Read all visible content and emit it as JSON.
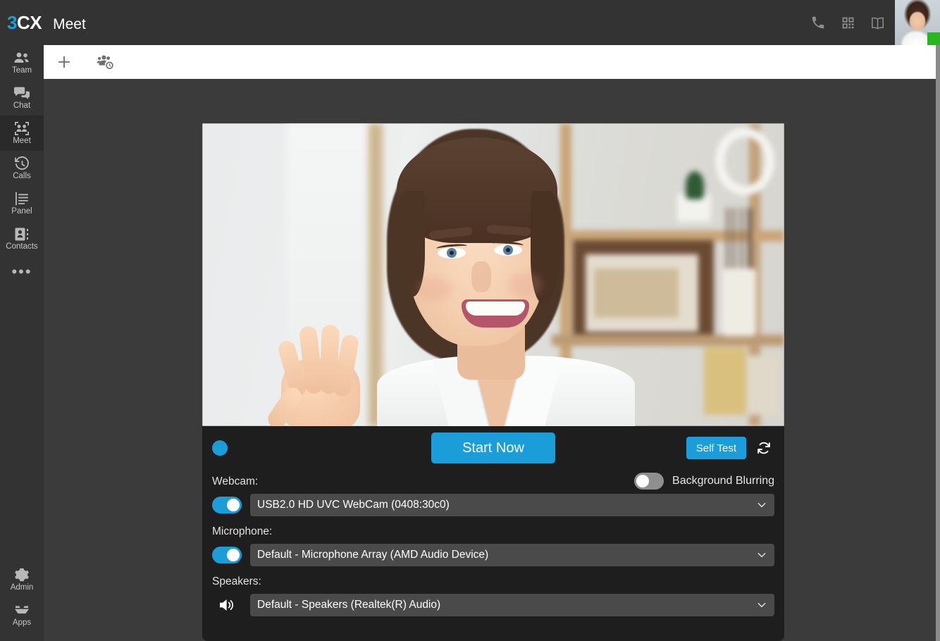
{
  "header": {
    "logo_prefix": "3",
    "logo_suffix": "CX",
    "app_title": "Meet",
    "icons": [
      {
        "name": "phone-icon",
        "label": "Make Call"
      },
      {
        "name": "qr-code-icon",
        "label": "QR Code"
      },
      {
        "name": "manual-icon",
        "label": "User Manual"
      }
    ],
    "avatar": {
      "name": "user-avatar",
      "status": "available",
      "status_color": "#2ab522"
    }
  },
  "sidebar": {
    "items": [
      {
        "label": "Team",
        "icon": "team-icon",
        "active": false
      },
      {
        "label": "Chat",
        "icon": "chat-icon",
        "active": false
      },
      {
        "label": "Meet",
        "icon": "meet-icon",
        "active": true
      },
      {
        "label": "Calls",
        "icon": "calls-icon",
        "active": false
      },
      {
        "label": "Panel",
        "icon": "panel-icon",
        "active": false
      },
      {
        "label": "Contacts",
        "icon": "contacts-icon",
        "active": false
      }
    ],
    "more_label": "•••",
    "bottom_items": [
      {
        "label": "Admin",
        "icon": "gear-icon"
      },
      {
        "label": "Apps",
        "icon": "apps-icon"
      }
    ]
  },
  "toolbar": {
    "buttons": [
      {
        "name": "new-meeting-button",
        "icon": "plus-icon"
      },
      {
        "name": "schedule-meeting-button",
        "icon": "group-clock-icon"
      }
    ]
  },
  "controls": {
    "record_dot_color": "#1b9dd9",
    "start_label": "Start Now",
    "self_test_label": "Self Test",
    "refresh_icon": "refresh-icon",
    "accent_color": "#1b9dd9"
  },
  "devices": {
    "webcam": {
      "label": "Webcam:",
      "enabled": true,
      "value": "USB2.0 HD UVC WebCam (0408:30c0)"
    },
    "background_blurring": {
      "label": "Background Blurring",
      "enabled": false
    },
    "microphone": {
      "label": "Microphone:",
      "enabled": true,
      "value": "Default - Microphone Array (AMD Audio Device)"
    },
    "speakers": {
      "label": "Speakers:",
      "icon": "speaker-icon",
      "value": "Default - Speakers (Realtek(R) Audio)"
    }
  },
  "video_preview": {
    "name": "camera-preview",
    "description": "Live webcam preview of a smiling woman in a white blazer waving at the camera in a blurred office with shelves"
  }
}
